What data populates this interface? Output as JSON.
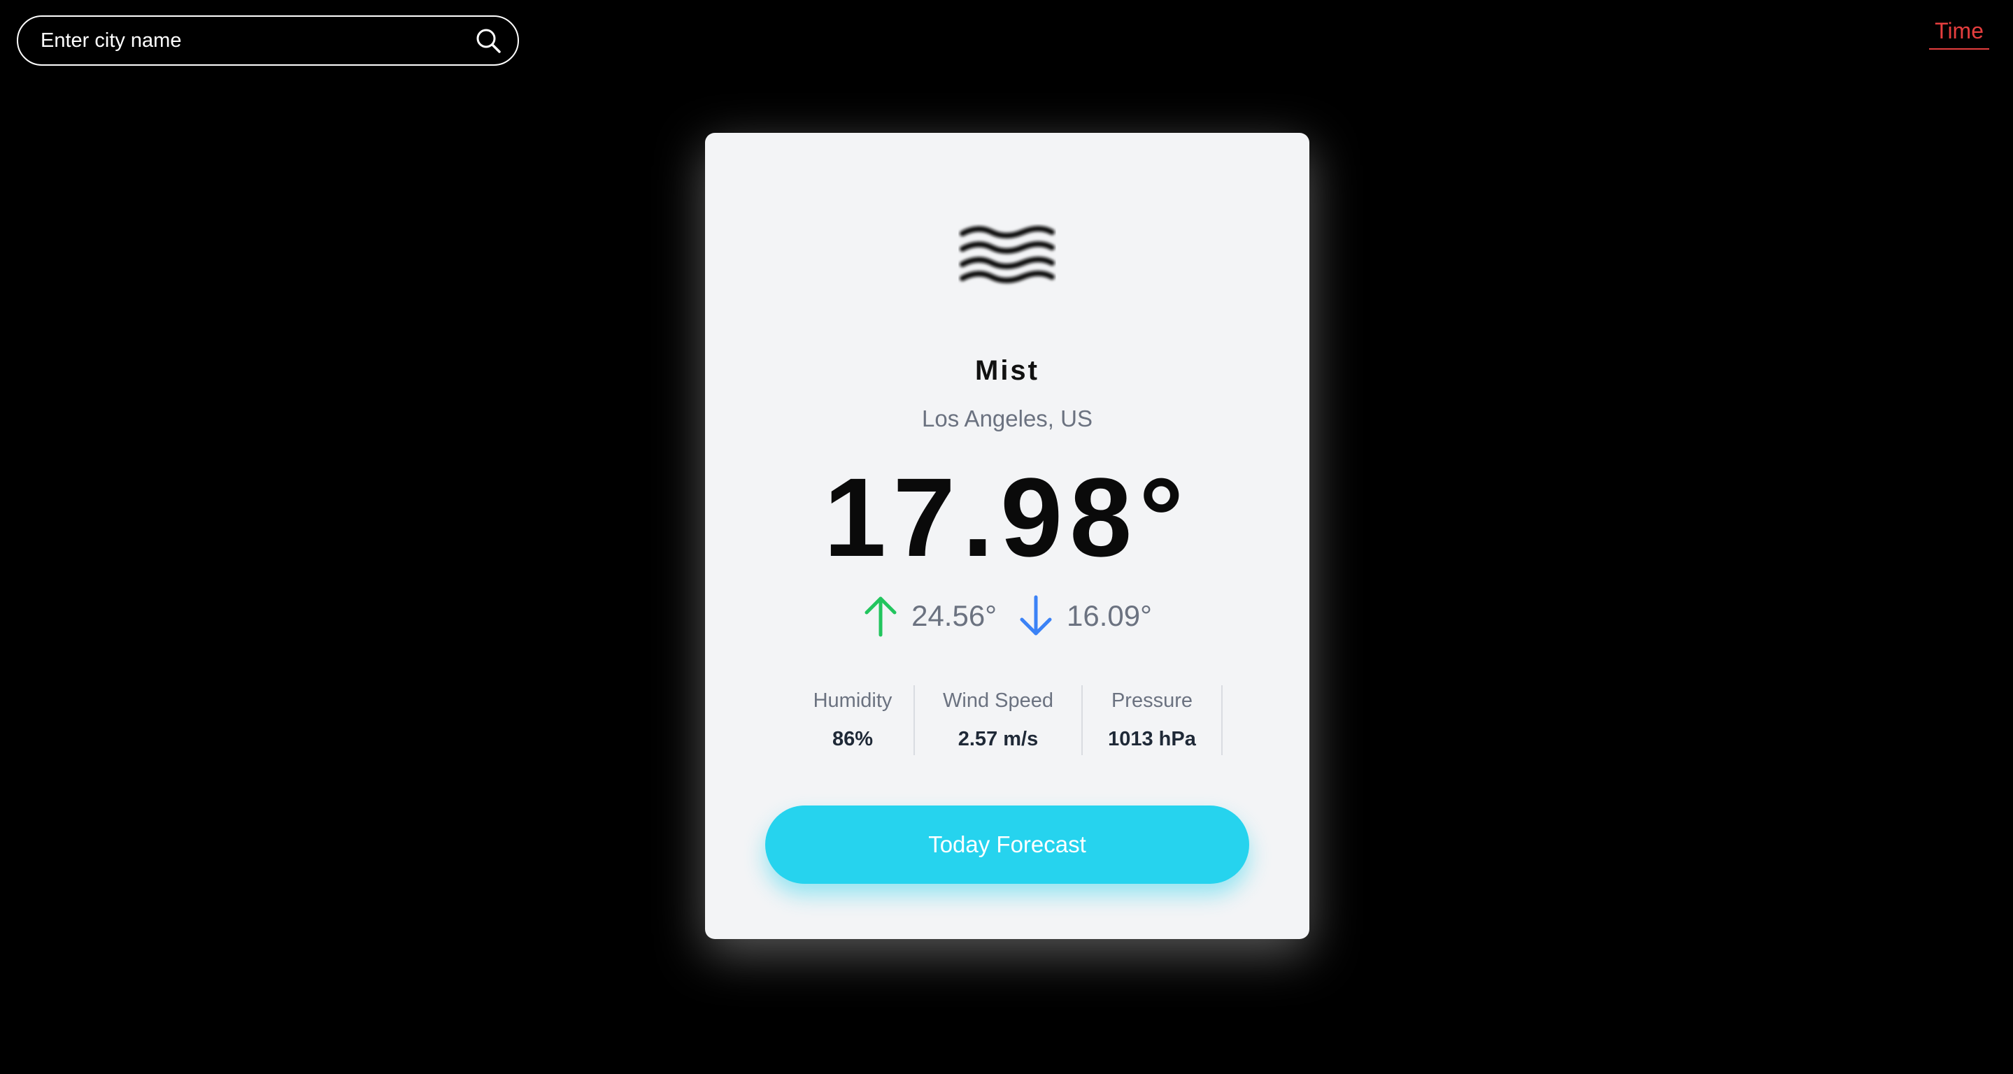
{
  "search": {
    "placeholder": "Enter city name",
    "value": ""
  },
  "nav": {
    "time_link": "Time"
  },
  "weather": {
    "icon": "mist-icon",
    "condition": "Mist",
    "location": "Los Angeles, US",
    "temperature": "17.98°",
    "max_temp": "24.56°",
    "min_temp": "16.09°",
    "stats": [
      {
        "label": "Humidity",
        "value": "86%"
      },
      {
        "label": "Wind Speed",
        "value": "2.57 m/s"
      },
      {
        "label": "Pressure",
        "value": "1013 hPa"
      }
    ],
    "forecast_button": "Today Forecast"
  },
  "colors": {
    "background": "#000000",
    "card": "#f3f4f6",
    "accent": "#26d3ee",
    "max_arrow": "#22c55e",
    "min_arrow": "#3b82f6",
    "time_link": "#e53e3e"
  }
}
